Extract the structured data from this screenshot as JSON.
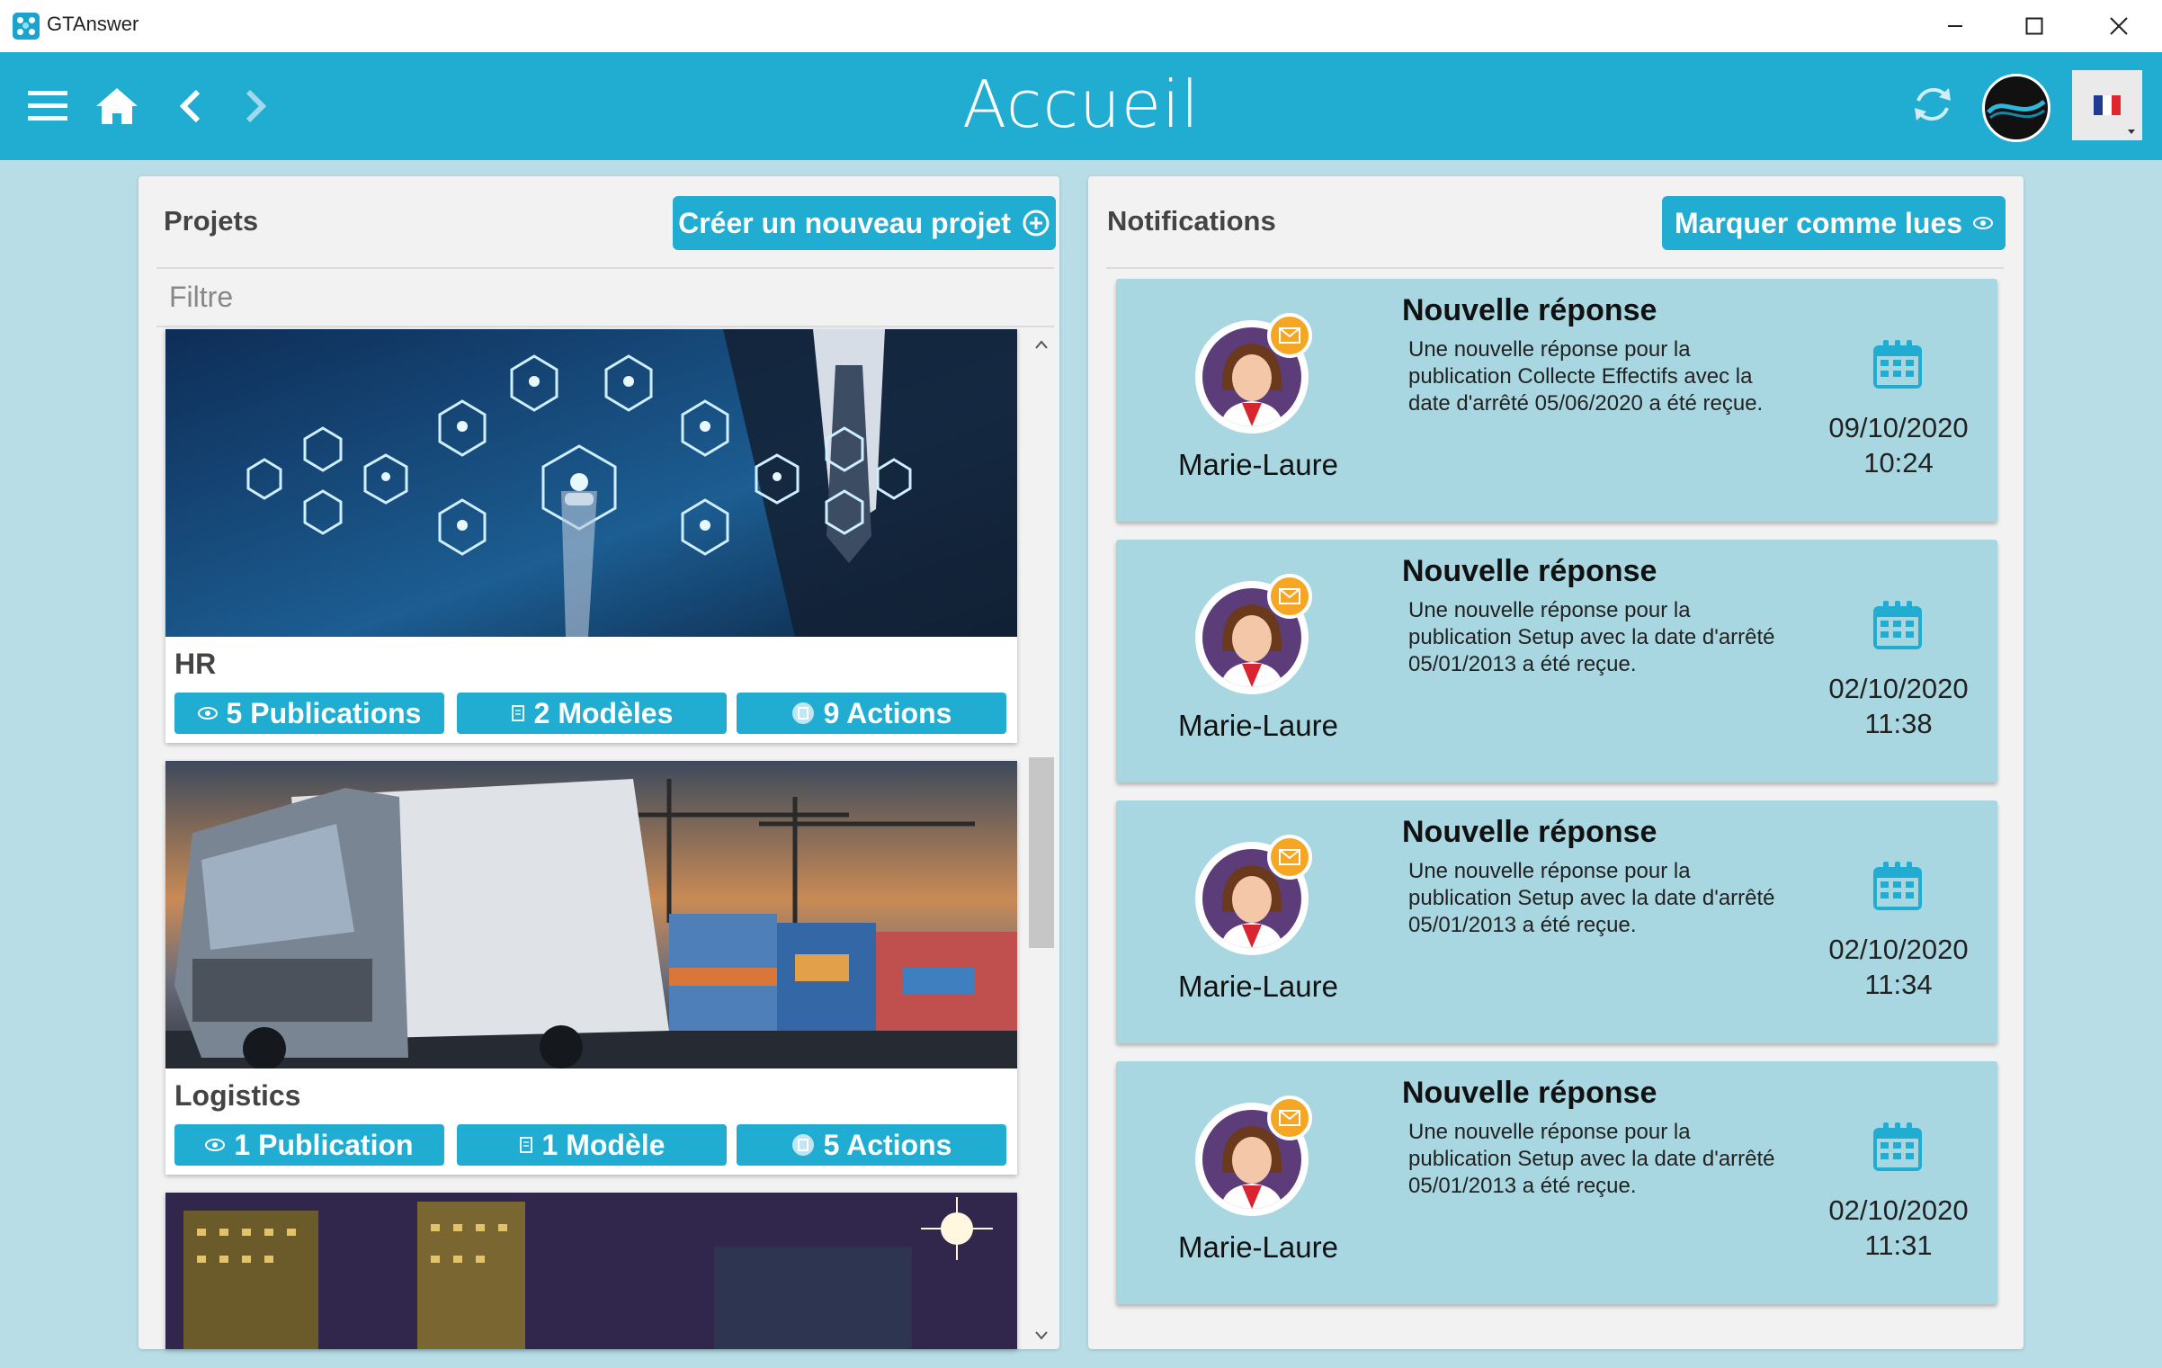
{
  "window": {
    "title": "GTAnswer"
  },
  "header": {
    "title": "Accueil",
    "language": "FR"
  },
  "projects": {
    "heading": "Projets",
    "create_button": "Créer un nouveau projet",
    "filter_placeholder": "Filtre",
    "items": [
      {
        "name": "HR",
        "publications": "5 Publications",
        "models": "2 Modèles",
        "actions": "9 Actions"
      },
      {
        "name": "Logistics",
        "publications": "1 Publication",
        "models": "1 Modèle",
        "actions": "5 Actions"
      }
    ]
  },
  "notifications": {
    "heading": "Notifications",
    "mark_read_button": "Marquer comme lues",
    "items": [
      {
        "title": "Nouvelle réponse",
        "author": "Marie-Laure",
        "body": "Une nouvelle réponse pour la publication Collecte Effectifs avec la date d'arrêté 05/06/2020 a été reçue.",
        "date": "09/10/2020",
        "time": "10:24"
      },
      {
        "title": "Nouvelle réponse",
        "author": "Marie-Laure",
        "body": "Une nouvelle réponse pour la publication Setup avec la date d'arrêté 05/01/2013 a été reçue.",
        "date": "02/10/2020",
        "time": "11:38"
      },
      {
        "title": "Nouvelle réponse",
        "author": "Marie-Laure",
        "body": "Une nouvelle réponse pour la publication Setup avec la date d'arrêté 05/01/2013 a été reçue.",
        "date": "02/10/2020",
        "time": "11:34"
      },
      {
        "title": "Nouvelle réponse",
        "author": "Marie-Laure",
        "body": "Une nouvelle réponse pour la publication Setup avec la date d'arrêté 05/01/2013 a été reçue.",
        "date": "02/10/2020",
        "time": "11:31"
      }
    ]
  },
  "colors": {
    "accent": "#21acd2",
    "background": "#b8dde6",
    "notification_card": "#a9d7e1",
    "badge": "#f5a623"
  }
}
